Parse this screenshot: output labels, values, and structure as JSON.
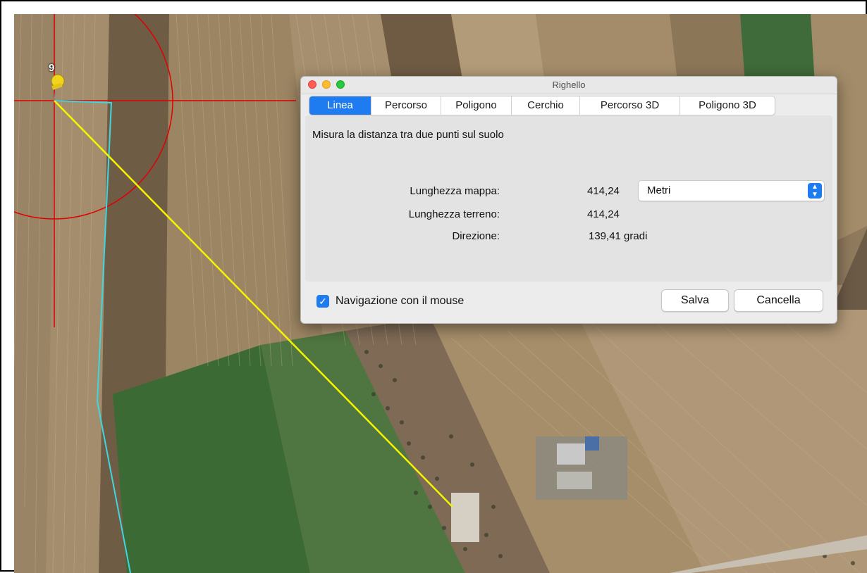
{
  "dialog": {
    "title": "Righello",
    "tabs": [
      {
        "label": "Linea",
        "active": true
      },
      {
        "label": "Percorso"
      },
      {
        "label": "Poligono"
      },
      {
        "label": "Cerchio"
      },
      {
        "label": "Percorso 3D"
      },
      {
        "label": "Poligono 3D"
      }
    ],
    "description": "Misura la distanza tra due punti sul suolo",
    "measurements": {
      "map_length_label": "Lunghezza mappa:",
      "map_length_value": "414,24",
      "ground_length_label": "Lunghezza terreno:",
      "ground_length_value": "414,24",
      "direction_label": "Direzione:",
      "direction_value": "139,41 gradi"
    },
    "unit_select": {
      "value": "Metri"
    },
    "mouse_nav": {
      "label": "Navigazione con il mouse",
      "checked": true
    },
    "save_label": "Salva",
    "cancel_label": "Cancella"
  },
  "map": {
    "pin_label": "9",
    "colors": {
      "measure_line": "#f5f500",
      "path_line": "#3fd6e0",
      "crosshair": "#e00000"
    }
  }
}
